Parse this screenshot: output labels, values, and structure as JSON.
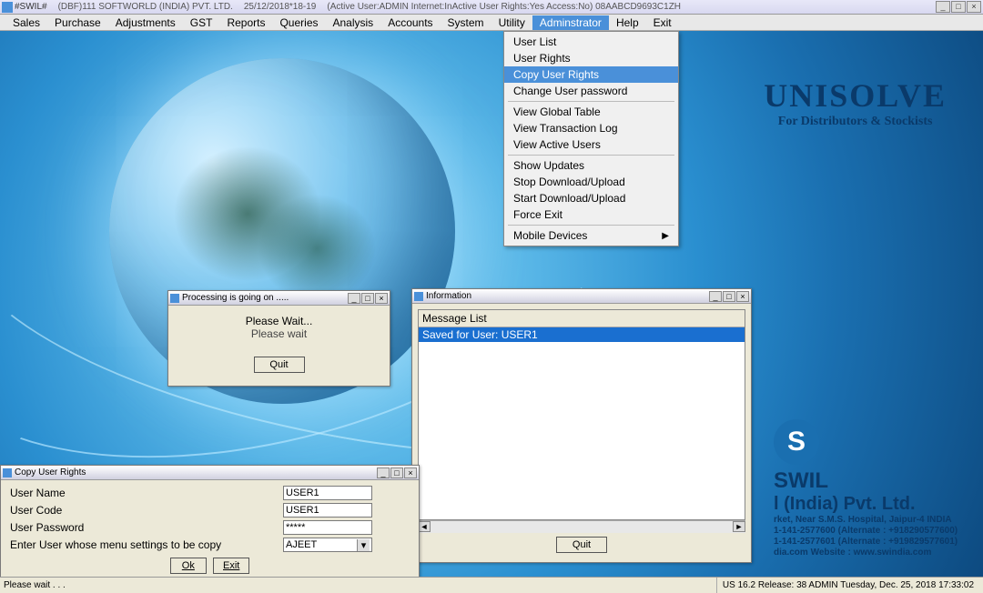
{
  "titlebar": {
    "app": "#SWIL#",
    "db": "(DBF)111 SOFTWORLD (INDIA) PVT. LTD.",
    "date": "25/12/2018*18-19",
    "session": "(Active User:ADMIN Internet:InActive User Rights:Yes Access:No) 08AABCD9693C1ZH",
    "min": "_",
    "max": "□",
    "close": "×"
  },
  "menubar": [
    "Sales",
    "Purchase",
    "Adjustments",
    "GST",
    "Reports",
    "Queries",
    "Analysis",
    "Accounts",
    "System",
    "Utility",
    "Adminstrator",
    "Help",
    "Exit"
  ],
  "dropdown": {
    "items": [
      {
        "label": "User List",
        "u": "L"
      },
      {
        "label": "User Rights",
        "u": "R"
      },
      {
        "label": "Copy User Rights",
        "u": "C",
        "hl": true
      },
      {
        "label": "Change User password",
        "u": "p"
      },
      {
        "sep": true
      },
      {
        "label": "View Global Table",
        "u": "G"
      },
      {
        "label": "View Transaction Log",
        "u": "T"
      },
      {
        "label": "View Active Users",
        "u": "U"
      },
      {
        "sep": true
      },
      {
        "label": "Show Updates",
        "u": "S"
      },
      {
        "label": "Stop Download/Upload"
      },
      {
        "label": "Start Download/Upload"
      },
      {
        "label": "Force Exit",
        "u": "F"
      },
      {
        "sep": true
      },
      {
        "label": "Mobile Devices",
        "u": "M",
        "sub": true
      }
    ]
  },
  "brand": {
    "title": "UNISOLVE",
    "sub": "For Distributors & Stockists"
  },
  "company": {
    "logo": "S",
    "name1": "SWIL",
    "name2": "l (India) Pvt. Ltd.",
    "addr1": "rket, Near S.M.S. Hospital, Jaipur-4 INDIA",
    "addr2": "1-141-2577600 (Alternate : +918290577600)",
    "addr3": "1-141-2577601 (Alternate : +919829577601)",
    "addr4": "dia.com   Website : www.swindia.com"
  },
  "processing": {
    "title": "Processing is going on .....",
    "line1": "Please Wait...",
    "line2": "Please wait",
    "quit": "Quit"
  },
  "info": {
    "title": "Information",
    "header": "Message List",
    "rows": [
      "Saved for User: USER1"
    ],
    "quit": "Quit"
  },
  "copy": {
    "title": "Copy User Rights",
    "fields": {
      "userName": {
        "label": "User Name",
        "value": "USER1"
      },
      "userCode": {
        "label": "User Code",
        "value": "USER1"
      },
      "userPass": {
        "label": "User Password",
        "value": "*****"
      },
      "copyFrom": {
        "label": "Enter User whose menu settings to be copy",
        "value": "AJEET"
      }
    },
    "ok": "Ok",
    "exit": "Exit"
  },
  "status": {
    "left": "Please wait . . .",
    "right": "US 16.2 Release: 38  ADMIN  Tuesday, Dec. 25, 2018  17:33:02"
  }
}
